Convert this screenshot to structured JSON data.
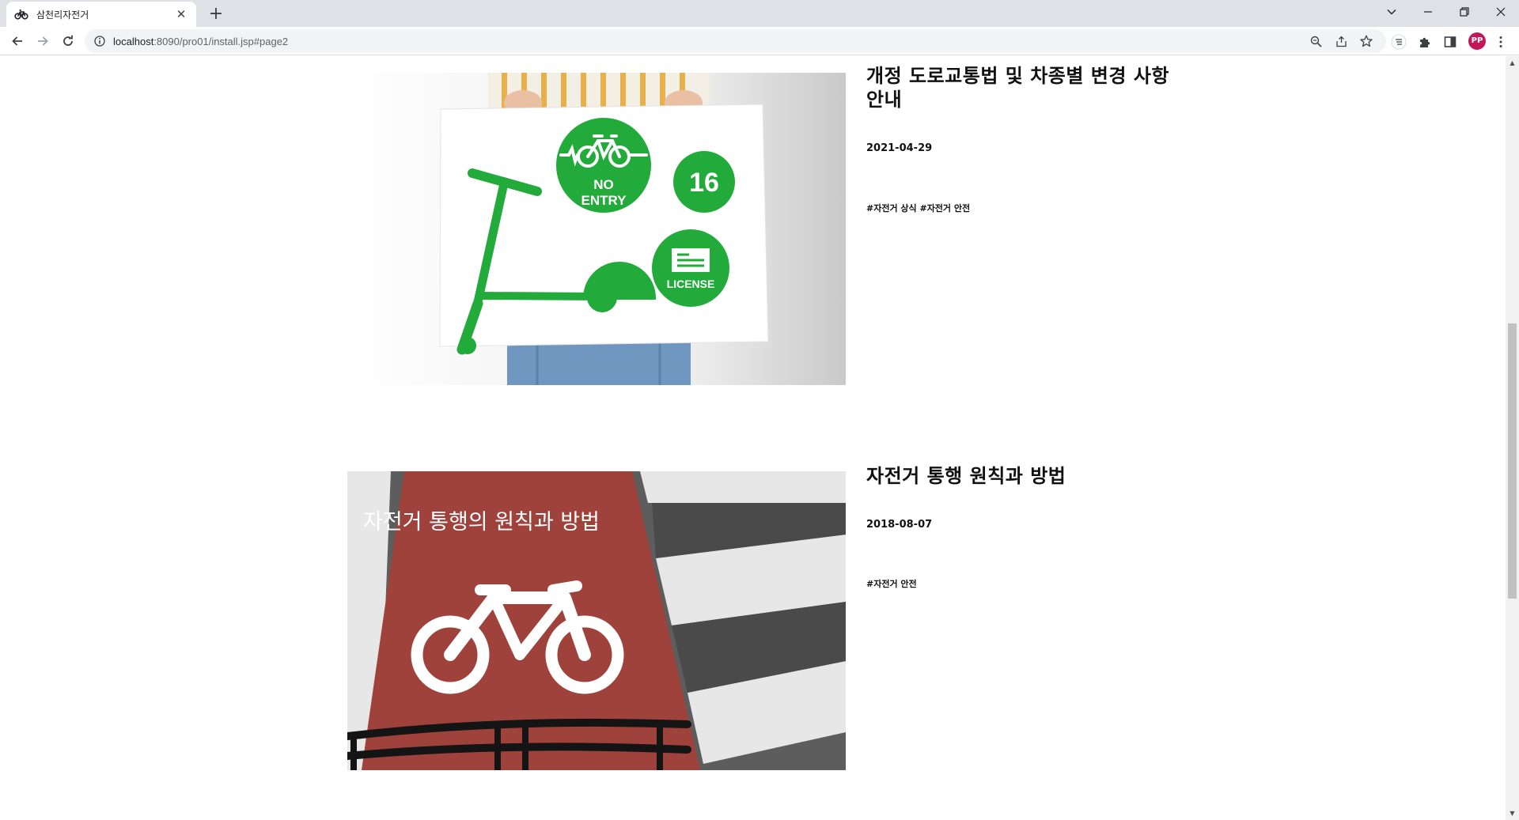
{
  "browser": {
    "tab_title": "삼천리자전거",
    "url_host": "localhost",
    "url_path": ":8090/pro01/install.jsp#page2",
    "profile_initials": "PP"
  },
  "articles": [
    {
      "title": "개정 도로교통법 및 차종별 변경 사항 안내",
      "date": "2021-04-29",
      "tags": "#자전거 상식 #자전거 안전",
      "image": {
        "sign_no_entry": "NO\nENTRY",
        "sign_no": "NO",
        "sign_entry": "ENTRY",
        "sign_age": "16",
        "sign_license": "LICENSE",
        "accent_color": "#22aa3a"
      }
    },
    {
      "title": "자전거 통행 원칙과 방법",
      "date": "2018-08-07",
      "tags": "#자전거 안전",
      "image": {
        "overlay_text": "자전거 통행의 원칙과 방법",
        "lane_color": "#a8463f"
      }
    }
  ]
}
